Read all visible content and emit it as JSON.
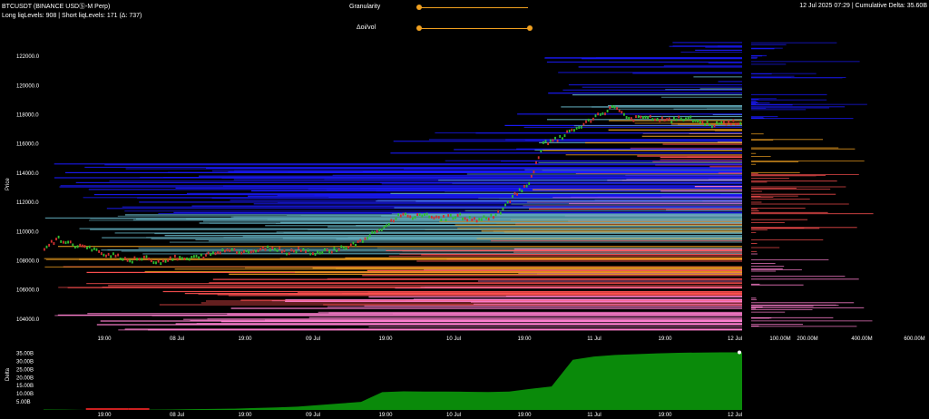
{
  "header": {
    "symbol_line": "BTCUSDT (BINANCE USDⓈ-M Perp)",
    "liq_line": "Long liqLevels: 908 | Short liqLevels: 171 (Δ: 737)",
    "right_info": "12 Jul 2025 07:29 | Cumulative Delta: 35.60B"
  },
  "controls": {
    "granularity_label": "Granularity",
    "granularity_value": 0.0,
    "oi_vol_label": "Δoi/vol",
    "oi_vol_value": 1.0
  },
  "colors": {
    "price_candle_up": "#2fbf2f",
    "price_candle_down": "#d23030",
    "heat_blue": "#1a1aff",
    "heat_teal": "#5fa8b8",
    "heat_orange": "#f0a020",
    "heat_red": "#ff5050",
    "heat_pink": "#ff80d0",
    "delta_fill": "#0a8a0a",
    "delta_neg": "#cc2020"
  },
  "chart_data": [
    {
      "type": "heatmap",
      "ylabel": "Price",
      "ylim": [
        103000,
        123500
      ],
      "yticks": [
        "122000.0",
        "120000.0",
        "118000.0",
        "116000.0",
        "114000.0",
        "112000.0",
        "110000.0",
        "108000.0",
        "106000.0",
        "104000.0"
      ],
      "ytick_values": [
        122000,
        120000,
        118000,
        116000,
        114000,
        112000,
        110000,
        108000,
        106000,
        104000
      ],
      "xticks": [
        "19:00",
        "08 Jul",
        "19:00",
        "09 Jul",
        "19:00",
        "10 Jul",
        "19:00",
        "11 Jul",
        "19:00",
        "12 Jul"
      ],
      "profile_ticks": [
        "100.00M",
        "200.00M",
        "400.00M",
        "600.00M"
      ],
      "price_series": [
        108900,
        109500,
        109100,
        108900,
        108500,
        108400,
        108000,
        108200,
        107900,
        108200,
        108100,
        108300,
        108500,
        108800,
        108600,
        108700,
        108900,
        108600,
        108800,
        108500,
        108700,
        108900,
        109200,
        109800,
        110400,
        111200,
        111000,
        111100,
        110900,
        111100,
        110800,
        110900,
        111300,
        112600,
        113200,
        116000,
        116300,
        116900,
        117400,
        118000,
        118600,
        117700,
        117800,
        117700,
        117600,
        117800,
        117500,
        117300,
        117500,
        117400
      ]
    },
    {
      "type": "area",
      "ylabel": "Delta",
      "yticks": [
        "35.00B",
        "30.00B",
        "25.00B",
        "20.00B",
        "15.00B",
        "10.00B",
        "5.00B"
      ],
      "ytick_values": [
        35,
        30,
        25,
        20,
        15,
        10,
        5
      ],
      "ylim": [
        0,
        37
      ],
      "xticks": [
        "19:00",
        "08 Jul",
        "19:00",
        "09 Jul",
        "19:00",
        "10 Jul",
        "19:00",
        "11 Jul",
        "19:00",
        "12 Jul"
      ],
      "values": [
        0.3,
        0.2,
        -0.3,
        -0.5,
        -0.4,
        0.2,
        0.3,
        0.5,
        0.6,
        0.8,
        1.2,
        1.5,
        2,
        3,
        4,
        5,
        11,
        11.5,
        11.3,
        11.4,
        11.2,
        11.1,
        11.3,
        13,
        14.5,
        31,
        33,
        34,
        34.5,
        35,
        35.3,
        35.5,
        35.6,
        35.6
      ]
    }
  ]
}
